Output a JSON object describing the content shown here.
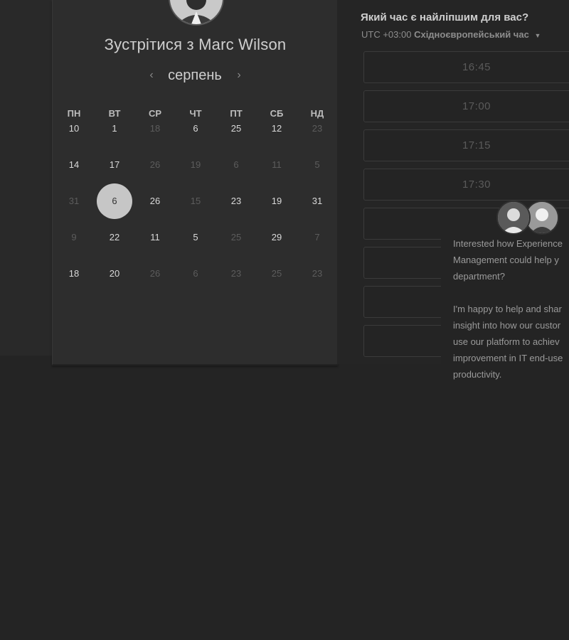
{
  "scheduler": {
    "title_prefix": "Зустрітися з",
    "host_name": "Marc Wilson",
    "month": "серпень",
    "weekdays": [
      "ПН",
      "ВТ",
      "СР",
      "ЧТ",
      "ПТ",
      "СБ",
      "НД"
    ],
    "weeks": [
      [
        {
          "d": "10",
          "m": false
        },
        {
          "d": "1",
          "m": false
        },
        {
          "d": "18",
          "m": true
        },
        {
          "d": "6",
          "m": false
        },
        {
          "d": "25",
          "m": false
        },
        {
          "d": "12",
          "m": false
        },
        {
          "d": "23",
          "m": true
        }
      ],
      [
        {
          "d": "14",
          "m": false
        },
        {
          "d": "17",
          "m": false
        },
        {
          "d": "26",
          "m": true
        },
        {
          "d": "19",
          "m": true
        },
        {
          "d": "6",
          "m": true
        },
        {
          "d": "11",
          "m": true
        },
        {
          "d": "5",
          "m": true
        }
      ],
      [
        {
          "d": "31",
          "m": true
        },
        {
          "d": "6",
          "m": false,
          "selected": true
        },
        {
          "d": "26",
          "m": false
        },
        {
          "d": "15",
          "m": true
        },
        {
          "d": "23",
          "m": false
        },
        {
          "d": "19",
          "m": false
        },
        {
          "d": "31",
          "m": false
        }
      ],
      [
        {
          "d": "9",
          "m": true
        },
        {
          "d": "22",
          "m": false
        },
        {
          "d": "11",
          "m": false
        },
        {
          "d": "5",
          "m": false
        },
        {
          "d": "25",
          "m": true
        },
        {
          "d": "29",
          "m": false
        },
        {
          "d": "7",
          "m": true
        }
      ],
      [
        {
          "d": "18",
          "m": false
        },
        {
          "d": "20",
          "m": false
        },
        {
          "d": "26",
          "m": true
        },
        {
          "d": "6",
          "m": true
        },
        {
          "d": "23",
          "m": true
        },
        {
          "d": "25",
          "m": true
        },
        {
          "d": "23",
          "m": true
        }
      ]
    ]
  },
  "time_picker": {
    "question": "Який час є найліпшим для вас?",
    "tz_offset": "UTC +03:00",
    "tz_name": "Східноєвропейський час",
    "slots": [
      "16:45",
      "17:00",
      "17:15",
      "17:30",
      "",
      "",
      "",
      ""
    ]
  },
  "chat": {
    "lines": [
      "Interested how Experience",
      "Management could help y",
      "department?",
      "",
      "I'm happy to help and shar",
      "insight into how our custor",
      "use our platform to achiev",
      "improvement in IT end-use",
      "productivity."
    ]
  }
}
